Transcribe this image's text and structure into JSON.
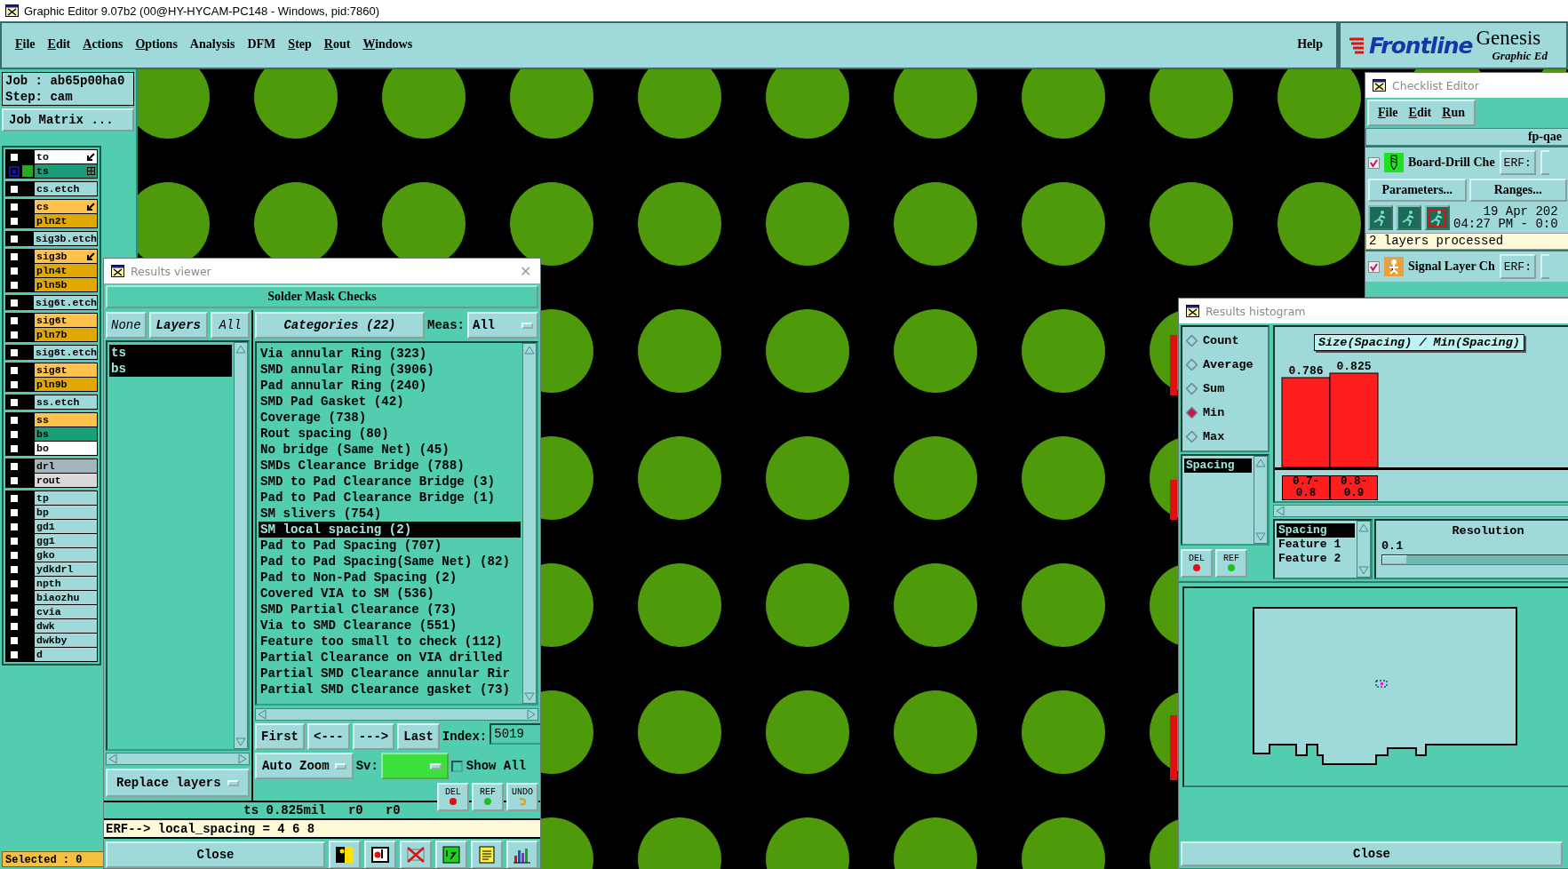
{
  "window": {
    "title": "Graphic Editor 9.07b2 (00@HY-HYCAM-PC148 - Windows, pid:7860)"
  },
  "menu": [
    {
      "label": "File",
      "underlined": true
    },
    {
      "label": "Edit",
      "underlined": true
    },
    {
      "label": "Actions",
      "underlined": true
    },
    {
      "label": "Options",
      "underlined": true
    },
    {
      "label": "Analysis",
      "underlined": false
    },
    {
      "label": "DFM",
      "underlined": false
    },
    {
      "label": "Step",
      "underlined": true
    },
    {
      "label": "Rout",
      "underlined": true
    },
    {
      "label": "Windows",
      "underlined": true
    }
  ],
  "help": "Help",
  "logo": {
    "brand": "Frontline",
    "product": "Genesis",
    "subtitle": "Graphic Ed"
  },
  "job": {
    "job": "Job : ab65p00ha0",
    "step": "Step: cam",
    "matrix_button": "Job Matrix ..."
  },
  "layer_groups": [
    [
      {
        "name": "to",
        "color": "#ffffff",
        "selected": false,
        "kind": "arrow"
      },
      {
        "name": "ts",
        "color": "#1a9e78",
        "selected": true,
        "kind": "grid"
      }
    ],
    [
      {
        "name": "cs.etch",
        "color": "#9fd9da",
        "selected": false,
        "kind": "plain"
      }
    ],
    [
      {
        "name": "cs",
        "color": "#ffc24d",
        "selected": false,
        "kind": "arrow"
      },
      {
        "name": "pln2t",
        "color": "#e0a800",
        "selected": false,
        "kind": "plain"
      }
    ],
    [
      {
        "name": "sig3b.etch",
        "color": "#9fd9da",
        "selected": false,
        "kind": "plain"
      }
    ],
    [
      {
        "name": "sig3b",
        "color": "#ffc24d",
        "selected": false,
        "kind": "arrow"
      },
      {
        "name": "pln4t",
        "color": "#e0a800",
        "selected": false,
        "kind": "plain"
      },
      {
        "name": "pln5b",
        "color": "#e0a800",
        "selected": false,
        "kind": "plain"
      }
    ],
    [
      {
        "name": "sig6t.etch",
        "color": "#9fd9da",
        "selected": false,
        "kind": "plain"
      }
    ],
    [
      {
        "name": "sig6t",
        "color": "#ffc24d",
        "selected": false,
        "kind": "plain"
      },
      {
        "name": "pln7b",
        "color": "#e0a800",
        "selected": false,
        "kind": "plain"
      }
    ],
    [
      {
        "name": "sig8t.etch",
        "color": "#9fd9da",
        "selected": false,
        "kind": "plain"
      }
    ],
    [
      {
        "name": "sig8t",
        "color": "#ffc24d",
        "selected": false,
        "kind": "plain"
      },
      {
        "name": "pln9b",
        "color": "#e0a800",
        "selected": false,
        "kind": "plain"
      }
    ],
    [
      {
        "name": "ss.etch",
        "color": "#9fd9da",
        "selected": false,
        "kind": "plain"
      }
    ],
    [
      {
        "name": "ss",
        "color": "#ffc24d",
        "selected": false,
        "kind": "plain"
      },
      {
        "name": "bs",
        "color": "#1a9e78",
        "selected": false,
        "kind": "plain"
      },
      {
        "name": "bo",
        "color": "#ffffff",
        "selected": false,
        "kind": "plain"
      }
    ],
    [
      {
        "name": "drl",
        "color": "#a3b5bd",
        "selected": false,
        "kind": "plain"
      },
      {
        "name": "rout",
        "color": "#d9d9d9",
        "selected": false,
        "kind": "plain"
      }
    ],
    [
      {
        "name": "tp",
        "color": "#9fd9da",
        "selected": false,
        "kind": "plain"
      },
      {
        "name": "bp",
        "color": "#9fd9da",
        "selected": false,
        "kind": "plain"
      },
      {
        "name": "gd1",
        "color": "#9fd9da",
        "selected": false,
        "kind": "plain"
      },
      {
        "name": "gg1",
        "color": "#9fd9da",
        "selected": false,
        "kind": "plain"
      },
      {
        "name": "gko",
        "color": "#9fd9da",
        "selected": false,
        "kind": "plain"
      },
      {
        "name": "ydkdrl",
        "color": "#9fd9da",
        "selected": false,
        "kind": "plain"
      },
      {
        "name": "npth",
        "color": "#9fd9da",
        "selected": false,
        "kind": "plain"
      },
      {
        "name": "biaozhu",
        "color": "#9fd9da",
        "selected": false,
        "kind": "plain"
      },
      {
        "name": "cvia",
        "color": "#9fd9da",
        "selected": false,
        "kind": "plain"
      },
      {
        "name": "dwk",
        "color": "#9fd9da",
        "selected": false,
        "kind": "plain"
      },
      {
        "name": "dwkby",
        "color": "#9fd9da",
        "selected": false,
        "kind": "plain"
      },
      {
        "name": "d",
        "color": "#9fd9da",
        "selected": false,
        "kind": "plain"
      }
    ]
  ],
  "selected_count": "Selected : 0",
  "results_viewer": {
    "title": "Results viewer",
    "close_glyph": "✕",
    "header": "Solder Mask Checks",
    "layer_buttons": [
      "None",
      "Layers",
      "All"
    ],
    "layers": [
      {
        "label": "ts",
        "selected": true
      },
      {
        "label": "bs",
        "selected": true
      }
    ],
    "replace_dropdown": "Replace layers",
    "categories_button": "Categories (22)",
    "meas_label": "Meas:",
    "meas_value": "All",
    "categories": [
      {
        "label": "Via annular Ring (323)",
        "selected": false
      },
      {
        "label": "SMD annular Ring (3906)",
        "selected": false
      },
      {
        "label": "Pad annular Ring (240)",
        "selected": false
      },
      {
        "label": "SMD Pad Gasket (42)",
        "selected": false
      },
      {
        "label": "Coverage (738)",
        "selected": false
      },
      {
        "label": "Rout spacing (80)",
        "selected": false
      },
      {
        "label": "No bridge (Same Net) (45)",
        "selected": false
      },
      {
        "label": "SMDs Clearance Bridge (788)",
        "selected": false
      },
      {
        "label": "SMD to Pad Clearance Bridge (3)",
        "selected": false
      },
      {
        "label": "Pad to Pad Clearance Bridge (1)",
        "selected": false
      },
      {
        "label": "SM slivers (754)",
        "selected": false
      },
      {
        "label": "SM local spacing (2)",
        "selected": true
      },
      {
        "label": "Pad to Pad Spacing (707)",
        "selected": false
      },
      {
        "label": "Pad to Pad Spacing(Same Net) (82)",
        "selected": false
      },
      {
        "label": "Pad to Non-Pad Spacing (2)",
        "selected": false
      },
      {
        "label": "Covered VIA to SM (536)",
        "selected": false
      },
      {
        "label": "SMD Partial Clearance (73)",
        "selected": false
      },
      {
        "label": "Via to SMD Clearance (551)",
        "selected": false
      },
      {
        "label": "Feature too small to check (112)",
        "selected": false
      },
      {
        "label": "Partial Clearance on VIA drilled",
        "selected": false
      },
      {
        "label": "Partial SMD Clearance annular Rir",
        "selected": false
      },
      {
        "label": "Partial SMD Clearance gasket (73)",
        "selected": false
      }
    ],
    "nav_buttons": [
      "First",
      "<---",
      "--->",
      "Last"
    ],
    "index_label": "Index:",
    "index_value": "5019",
    "zoom_dropdown": "Auto Zoom",
    "sv_label": "Sv:",
    "show_all": {
      "label": "Show All",
      "checked": false
    },
    "tool_buttons": [
      {
        "label": "DEL",
        "kind": "delete"
      },
      {
        "label": "REF",
        "kind": "refresh"
      },
      {
        "label": "UNDO",
        "kind": "undo"
      }
    ],
    "status": "ts 0.825mil   r0   r0",
    "erf_line": "ERF--> local_spacing = 4 6 8",
    "close": "Close",
    "bottom_icons": [
      {
        "kind": "person"
      },
      {
        "kind": "display"
      },
      {
        "kind": "cross"
      },
      {
        "kind": "half"
      },
      {
        "kind": "notes"
      },
      {
        "kind": "bars"
      }
    ]
  },
  "checklist_editor": {
    "title": "Checklist Editor",
    "menu": [
      "File",
      "Edit",
      "Run"
    ],
    "name": "fp-qae",
    "checks": [
      {
        "name": "Board-Drill Che",
        "kind": "drill",
        "checked": true,
        "erf": "ERF:"
      },
      {
        "name": "Signal Layer Ch",
        "kind": "signal",
        "checked": true,
        "erf": "ERF:"
      }
    ],
    "buttons": [
      "Parameters...",
      "Ranges..."
    ],
    "date": "19 Apr 202",
    "time": "04:27 PM - 0:0",
    "status": "2 layers processed"
  },
  "histogram": {
    "title": "Results histogram",
    "measures": [
      {
        "label": "Count",
        "selected": false
      },
      {
        "label": "Average",
        "selected": false
      },
      {
        "label": "Sum",
        "selected": false
      },
      {
        "label": "Min",
        "selected": true
      },
      {
        "label": "Max",
        "selected": false
      }
    ],
    "attributes": [
      {
        "label": "Spacing",
        "selected": true
      }
    ],
    "tool_buttons": [
      {
        "label": "DEL",
        "kind": "delete"
      },
      {
        "label": "REF",
        "kind": "refresh"
      }
    ],
    "chart_data": {
      "type": "bar",
      "title": "Size(Spacing) / Min(Spacing)",
      "categories": [
        "0.7-0.8",
        "0.8-0.9"
      ],
      "values": [
        0.786,
        0.825
      ],
      "data_labels": true
    },
    "fields": [
      {
        "label": "Spacing",
        "selected": true
      },
      {
        "label": "Feature 1",
        "selected": false
      },
      {
        "label": "Feature 2",
        "selected": false
      }
    ],
    "resolution": {
      "label": "Resolution",
      "value": "0.1",
      "level": 0
    },
    "close": "Close"
  }
}
